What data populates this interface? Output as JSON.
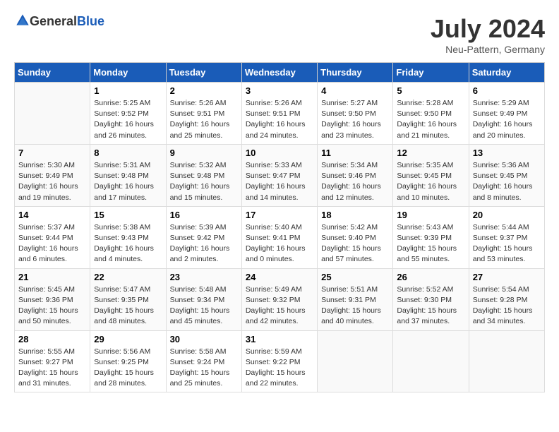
{
  "header": {
    "logo_general": "General",
    "logo_blue": "Blue",
    "month_year": "July 2024",
    "location": "Neu-Pattern, Germany"
  },
  "days_of_week": [
    "Sunday",
    "Monday",
    "Tuesday",
    "Wednesday",
    "Thursday",
    "Friday",
    "Saturday"
  ],
  "weeks": [
    [
      {
        "day": "",
        "info": ""
      },
      {
        "day": "1",
        "info": "Sunrise: 5:25 AM\nSunset: 9:52 PM\nDaylight: 16 hours\nand 26 minutes."
      },
      {
        "day": "2",
        "info": "Sunrise: 5:26 AM\nSunset: 9:51 PM\nDaylight: 16 hours\nand 25 minutes."
      },
      {
        "day": "3",
        "info": "Sunrise: 5:26 AM\nSunset: 9:51 PM\nDaylight: 16 hours\nand 24 minutes."
      },
      {
        "day": "4",
        "info": "Sunrise: 5:27 AM\nSunset: 9:50 PM\nDaylight: 16 hours\nand 23 minutes."
      },
      {
        "day": "5",
        "info": "Sunrise: 5:28 AM\nSunset: 9:50 PM\nDaylight: 16 hours\nand 21 minutes."
      },
      {
        "day": "6",
        "info": "Sunrise: 5:29 AM\nSunset: 9:49 PM\nDaylight: 16 hours\nand 20 minutes."
      }
    ],
    [
      {
        "day": "7",
        "info": "Sunrise: 5:30 AM\nSunset: 9:49 PM\nDaylight: 16 hours\nand 19 minutes."
      },
      {
        "day": "8",
        "info": "Sunrise: 5:31 AM\nSunset: 9:48 PM\nDaylight: 16 hours\nand 17 minutes."
      },
      {
        "day": "9",
        "info": "Sunrise: 5:32 AM\nSunset: 9:48 PM\nDaylight: 16 hours\nand 15 minutes."
      },
      {
        "day": "10",
        "info": "Sunrise: 5:33 AM\nSunset: 9:47 PM\nDaylight: 16 hours\nand 14 minutes."
      },
      {
        "day": "11",
        "info": "Sunrise: 5:34 AM\nSunset: 9:46 PM\nDaylight: 16 hours\nand 12 minutes."
      },
      {
        "day": "12",
        "info": "Sunrise: 5:35 AM\nSunset: 9:45 PM\nDaylight: 16 hours\nand 10 minutes."
      },
      {
        "day": "13",
        "info": "Sunrise: 5:36 AM\nSunset: 9:45 PM\nDaylight: 16 hours\nand 8 minutes."
      }
    ],
    [
      {
        "day": "14",
        "info": "Sunrise: 5:37 AM\nSunset: 9:44 PM\nDaylight: 16 hours\nand 6 minutes."
      },
      {
        "day": "15",
        "info": "Sunrise: 5:38 AM\nSunset: 9:43 PM\nDaylight: 16 hours\nand 4 minutes."
      },
      {
        "day": "16",
        "info": "Sunrise: 5:39 AM\nSunset: 9:42 PM\nDaylight: 16 hours\nand 2 minutes."
      },
      {
        "day": "17",
        "info": "Sunrise: 5:40 AM\nSunset: 9:41 PM\nDaylight: 16 hours\nand 0 minutes."
      },
      {
        "day": "18",
        "info": "Sunrise: 5:42 AM\nSunset: 9:40 PM\nDaylight: 15 hours\nand 57 minutes."
      },
      {
        "day": "19",
        "info": "Sunrise: 5:43 AM\nSunset: 9:39 PM\nDaylight: 15 hours\nand 55 minutes."
      },
      {
        "day": "20",
        "info": "Sunrise: 5:44 AM\nSunset: 9:37 PM\nDaylight: 15 hours\nand 53 minutes."
      }
    ],
    [
      {
        "day": "21",
        "info": "Sunrise: 5:45 AM\nSunset: 9:36 PM\nDaylight: 15 hours\nand 50 minutes."
      },
      {
        "day": "22",
        "info": "Sunrise: 5:47 AM\nSunset: 9:35 PM\nDaylight: 15 hours\nand 48 minutes."
      },
      {
        "day": "23",
        "info": "Sunrise: 5:48 AM\nSunset: 9:34 PM\nDaylight: 15 hours\nand 45 minutes."
      },
      {
        "day": "24",
        "info": "Sunrise: 5:49 AM\nSunset: 9:32 PM\nDaylight: 15 hours\nand 42 minutes."
      },
      {
        "day": "25",
        "info": "Sunrise: 5:51 AM\nSunset: 9:31 PM\nDaylight: 15 hours\nand 40 minutes."
      },
      {
        "day": "26",
        "info": "Sunrise: 5:52 AM\nSunset: 9:30 PM\nDaylight: 15 hours\nand 37 minutes."
      },
      {
        "day": "27",
        "info": "Sunrise: 5:54 AM\nSunset: 9:28 PM\nDaylight: 15 hours\nand 34 minutes."
      }
    ],
    [
      {
        "day": "28",
        "info": "Sunrise: 5:55 AM\nSunset: 9:27 PM\nDaylight: 15 hours\nand 31 minutes."
      },
      {
        "day": "29",
        "info": "Sunrise: 5:56 AM\nSunset: 9:25 PM\nDaylight: 15 hours\nand 28 minutes."
      },
      {
        "day": "30",
        "info": "Sunrise: 5:58 AM\nSunset: 9:24 PM\nDaylight: 15 hours\nand 25 minutes."
      },
      {
        "day": "31",
        "info": "Sunrise: 5:59 AM\nSunset: 9:22 PM\nDaylight: 15 hours\nand 22 minutes."
      },
      {
        "day": "",
        "info": ""
      },
      {
        "day": "",
        "info": ""
      },
      {
        "day": "",
        "info": ""
      }
    ]
  ]
}
